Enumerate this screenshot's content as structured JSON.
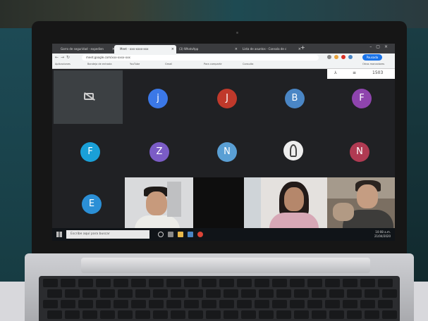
{
  "browser": {
    "tabs": [
      {
        "title": "Gorro de seguridad - expedien"
      },
      {
        "title": "Meet - xxx-xxxx-xxx"
      },
      {
        "title": "(3) WhatsApp"
      },
      {
        "title": "Lista de asuntos - Consola de c"
      }
    ],
    "url": "meet.google.com/xxx-xxxx-xxx",
    "profile_label": "Pausada",
    "bookmarks": [
      "Aplicaciones",
      "Bandeja de entrada",
      "YouTube",
      "Gmail",
      "Para compartir",
      "Consulta",
      "Otros marcadores"
    ]
  },
  "meet": {
    "top_count": "1503",
    "participants": [
      {
        "initial": "j",
        "color": "#3b78e7"
      },
      {
        "initial": "J",
        "color": "#c0392b"
      },
      {
        "initial": "B",
        "color": "#4a86c5"
      },
      {
        "initial": "F",
        "color": "#8e44ad"
      },
      {
        "initial": "F",
        "color": "#1aa0d8"
      },
      {
        "initial": "Z",
        "color": "#7b5cc6"
      },
      {
        "initial": "N",
        "color": "#5a9fd4"
      },
      {
        "initial": "N",
        "color": "#b03a52"
      },
      {
        "initial": "E",
        "color": "#2b8fd6"
      }
    ]
  },
  "taskbar": {
    "search_placeholder": "Escribe aquí para buscar",
    "time": "10:08 a.m.",
    "date": "21/04/2020"
  }
}
